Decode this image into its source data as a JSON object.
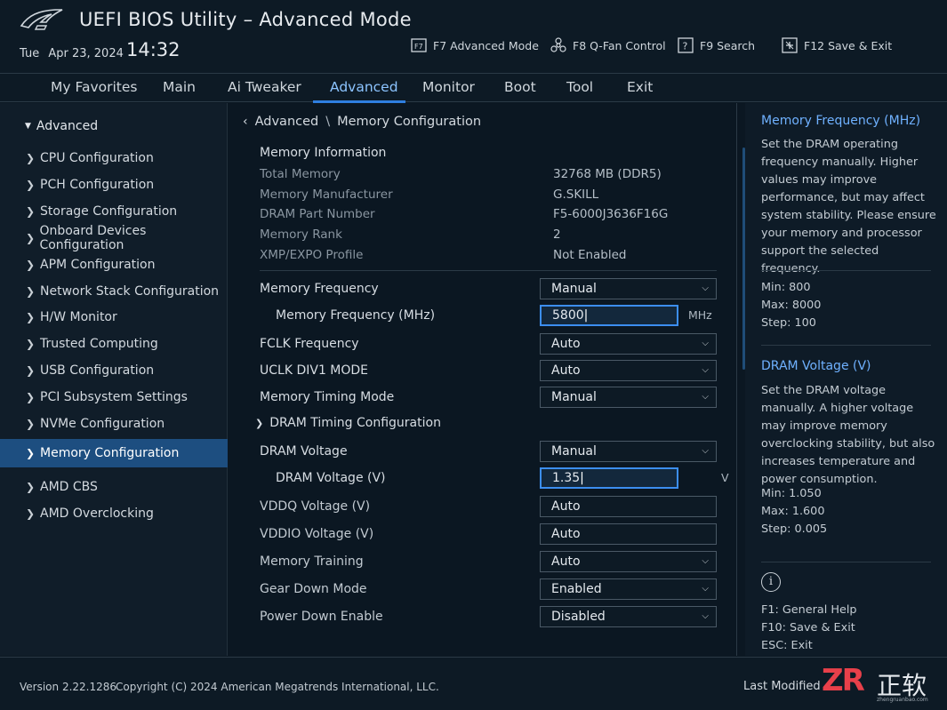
{
  "header": {
    "title": "UEFI BIOS Utility – Advanced Mode",
    "day": "Tue",
    "date": "Apr 23, 2024",
    "time": "14:32",
    "hotkeys": [
      {
        "label": "F7 Advanced Mode",
        "icon": "advanced-mode-icon"
      },
      {
        "label": "F8 Q-Fan Control",
        "icon": "fan-icon"
      },
      {
        "label": "F9 Search",
        "icon": "search-icon"
      },
      {
        "label": "F12 Save & Exit",
        "icon": "save-exit-icon"
      }
    ]
  },
  "tabs": [
    {
      "label": "My Favorites"
    },
    {
      "label": "Main"
    },
    {
      "label": "Ai Tweaker"
    },
    {
      "label": "Advanced",
      "active": true
    },
    {
      "label": "Monitor"
    },
    {
      "label": "Boot"
    },
    {
      "label": "Tool"
    },
    {
      "label": "Exit"
    }
  ],
  "sidebar": {
    "heading": "Advanced",
    "items": [
      {
        "label": "CPU Configuration"
      },
      {
        "label": "PCH Configuration"
      },
      {
        "label": "Storage Configuration"
      },
      {
        "label": "Onboard Devices Configuration"
      },
      {
        "label": "APM Configuration"
      },
      {
        "label": "Network Stack Configuration"
      },
      {
        "label": "H/W Monitor"
      },
      {
        "label": "Trusted Computing"
      },
      {
        "label": "USB Configuration"
      },
      {
        "label": "PCI Subsystem Settings"
      },
      {
        "label": "NVMe Configuration"
      },
      {
        "label": "Memory Configuration",
        "active": true
      },
      {
        "label": "AMD CBS"
      },
      {
        "label": "AMD Overclocking"
      }
    ]
  },
  "main": {
    "breadcrumb": {
      "parent": "Advanced",
      "separator": "\\",
      "current": "Memory Configuration"
    },
    "info": {
      "heading": "Memory Information",
      "rows": [
        {
          "key": "Total Memory",
          "value": "32768 MB (DDR5)"
        },
        {
          "key": "Memory Manufacturer",
          "value": "G.SKILL"
        },
        {
          "key": "DRAM Part Number",
          "value": "F5-6000J3636F16G"
        },
        {
          "key": "Memory Rank",
          "value": "2"
        },
        {
          "key": "XMP/EXPO Profile",
          "value": "Not Enabled"
        }
      ]
    },
    "settings": {
      "mem_freq": {
        "label": "Memory Frequency",
        "value": "Manual"
      },
      "mem_freq_mhz": {
        "label": "Memory Frequency (MHz)",
        "value": "5800",
        "unit": "MHz"
      },
      "fclk": {
        "label": "FCLK Frequency",
        "value": "Auto"
      },
      "uclk": {
        "label": "UCLK DIV1 MODE",
        "value": "Auto"
      },
      "timing_mode": {
        "label": "Memory Timing Mode",
        "value": "Manual"
      },
      "dram_timing": {
        "label": "DRAM Timing Configuration"
      },
      "dram_voltage": {
        "label": "DRAM Voltage",
        "value": "Manual"
      },
      "dram_voltage_v": {
        "label": "DRAM Voltage (V)",
        "value": "1.35",
        "unit": "V"
      },
      "vddq": {
        "label": "VDDQ Voltage (V)",
        "value": "Auto"
      },
      "vddio": {
        "label": "VDDIO Voltage (V)",
        "value": "Auto"
      },
      "training": {
        "label": "Memory Training",
        "value": "Auto"
      },
      "gear_down": {
        "label": "Gear Down Mode",
        "value": "Enabled"
      },
      "power_down": {
        "label": "Power Down Enable",
        "value": "Disabled"
      }
    }
  },
  "help": {
    "freq_title": "Memory Frequency (MHz)",
    "freq_desc": "Set the DRAM operating frequency manually. Higher values may improve performance, but may affect system stability. Please ensure your memory and processor support the selected frequency.",
    "freq_min": "Min: 800",
    "freq_max": "Max: 8000",
    "freq_step": "Step: 100",
    "volt_title": "DRAM Voltage (V)",
    "volt_desc": "Set the DRAM voltage manually. A higher voltage may improve memory overclocking stability, but also increases temperature and power consumption.",
    "volt_min": "Min: 1.050",
    "volt_max": "Max: 1.600",
    "volt_step": "Step: 0.005",
    "keys": [
      "F1: General Help",
      "F10: Save & Exit",
      "ESC: Exit"
    ]
  },
  "footer": {
    "version": "Version 2.22.1286",
    "copyright": "Copyright (C) 2024 American Megatrends International, LLC.",
    "last_modified": "Last Modified",
    "watermark_logo": "ZR",
    "watermark_text": "正软",
    "watermark_url": "zhengruanbao.com"
  },
  "colors": {
    "accent": "#2f7fe0",
    "active_tab": "#8cc4ff",
    "help_title": "#6fb1ff",
    "selected_bg": "#1d4e80",
    "watermark": "#e8404a"
  }
}
